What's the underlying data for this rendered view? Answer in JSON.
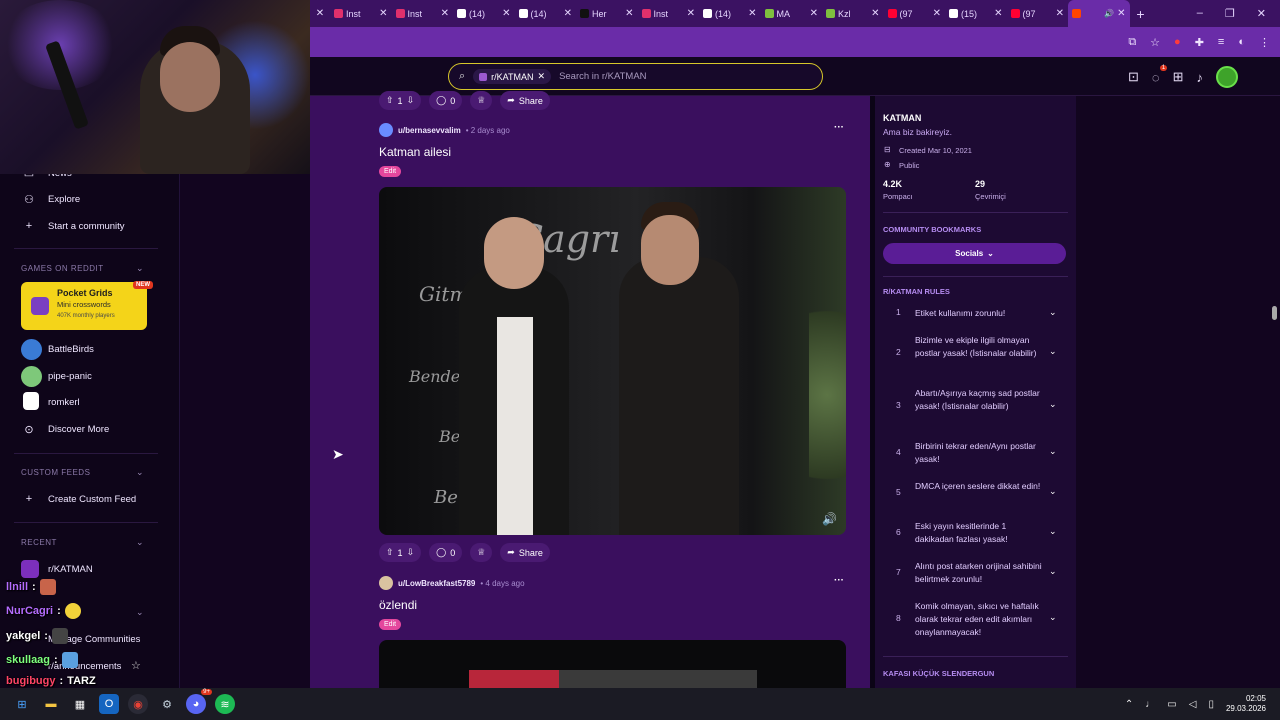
{
  "browser": {
    "tabs": [
      {
        "label": "Inst",
        "color": "#e1306c"
      },
      {
        "label": "Inst",
        "color": "#e1306c"
      },
      {
        "label": "(14)",
        "color": "#ffffff"
      },
      {
        "label": "(14)",
        "color": "#ffffff"
      },
      {
        "label": "Her",
        "color": "#111111"
      },
      {
        "label": "Inst",
        "color": "#e1306c"
      },
      {
        "label": "(14)",
        "color": "#ffffff"
      },
      {
        "label": "MA",
        "color": "#7fbf3f"
      },
      {
        "label": "Kzl",
        "color": "#7fbf3f"
      },
      {
        "label": "(97",
        "color": "#ff0033"
      },
      {
        "label": "(15)",
        "color": "#ffffff"
      },
      {
        "label": "(97",
        "color": "#ff0033"
      },
      {
        "label": "",
        "color": "#ff4500",
        "active": true
      }
    ],
    "new_tab": "+",
    "window_controls": [
      "–",
      "❐",
      "✕"
    ]
  },
  "header": {
    "search_chip": "r/KATMAN",
    "search_placeholder": "Search in r/KATMAN",
    "notif_badge": "1"
  },
  "sidebar": {
    "nav": [
      {
        "label": "News",
        "icon": "news-icon"
      },
      {
        "label": "Explore",
        "icon": "explore-icon"
      },
      {
        "label": "Start a community",
        "icon": "plus-icon"
      }
    ],
    "games_title": "GAMES ON REDDIT",
    "featured_game": {
      "title": "Pocket Grids",
      "subtitle": "Mini crosswords",
      "meta": "407K monthly players",
      "badge": "NEW"
    },
    "games": [
      "BattleBirds",
      "pipe-panic",
      "romkerl",
      "Discover More"
    ],
    "custom_feeds_title": "CUSTOM FEEDS",
    "create_feed": "Create Custom Feed",
    "recent_title": "RECENT",
    "recent": [
      "r/KATMAN"
    ],
    "communities": [
      "Manage Communities",
      "r/announcements"
    ]
  },
  "chat": [
    {
      "user": "llnill",
      "color": "#b56cff",
      "msg": ""
    },
    {
      "user": "NurCagri",
      "color": "#b56cff",
      "msg": ""
    },
    {
      "user": "yakgel",
      "color": "#ffffff",
      "msg": ""
    },
    {
      "user": "skullaag",
      "color": "#ffffff",
      "msg": ""
    },
    {
      "user": "bugibugy",
      "color": "#ff4466",
      "msg": "TARZ"
    }
  ],
  "posts": [
    {
      "author": "u/bernasevvalim",
      "time": "• 2 days ago",
      "title": "Katman ailesi",
      "flair": "Edit"
    },
    {
      "author": "u/LowBreakfast5789",
      "time": "• 4 days ago",
      "title": "özlendi",
      "flair": "Edit"
    }
  ],
  "actions": {
    "votes": "1",
    "comments": "0",
    "share": "Share"
  },
  "community": {
    "name": "KATMAN",
    "tagline": "Ama biz bakireyiz.",
    "created": "Created Mar 10, 2021",
    "visibility": "Public",
    "members": "4.2K",
    "members_label": "Pompacı",
    "online": "29",
    "online_label": "Çevrimiçi",
    "bookmarks_title": "COMMUNITY BOOKMARKS",
    "bookmark_button": "Socials",
    "rules_title": "R/KATMAN RULES",
    "rules": [
      {
        "n": "1",
        "text": "Etiket kullanımı zorunlu!"
      },
      {
        "n": "2",
        "text": "Bizimle ve ekiple ilgili olmayan postlar yasak! (İstisnalar olabilir)"
      },
      {
        "n": "3",
        "text": "Abartı/Aşırıya kaçmış sad postlar yasak! (İstisnalar olabilir)"
      },
      {
        "n": "4",
        "text": "Birbirini tekrar eden/Aynı postlar yasak!"
      },
      {
        "n": "5",
        "text": "DMCA içeren seslere dikkat edin!"
      },
      {
        "n": "6",
        "text": "Eski yayın kesitlerinde 1 dakikadan fazlası yasak!"
      },
      {
        "n": "7",
        "text": "Alıntı post atarken orijinal sahibini belirtmek zorunlu!"
      },
      {
        "n": "8",
        "text": "Komik olmayan, sıkıcı ve haftalık olarak tekrar eden edit akımları onaylanmayacak!"
      }
    ],
    "next_section": "KAFASI KÜÇÜK SLENDERGUN"
  },
  "taskbar": {
    "time": "02:05",
    "date": "29.03.2026",
    "discord_badge": "9+"
  }
}
